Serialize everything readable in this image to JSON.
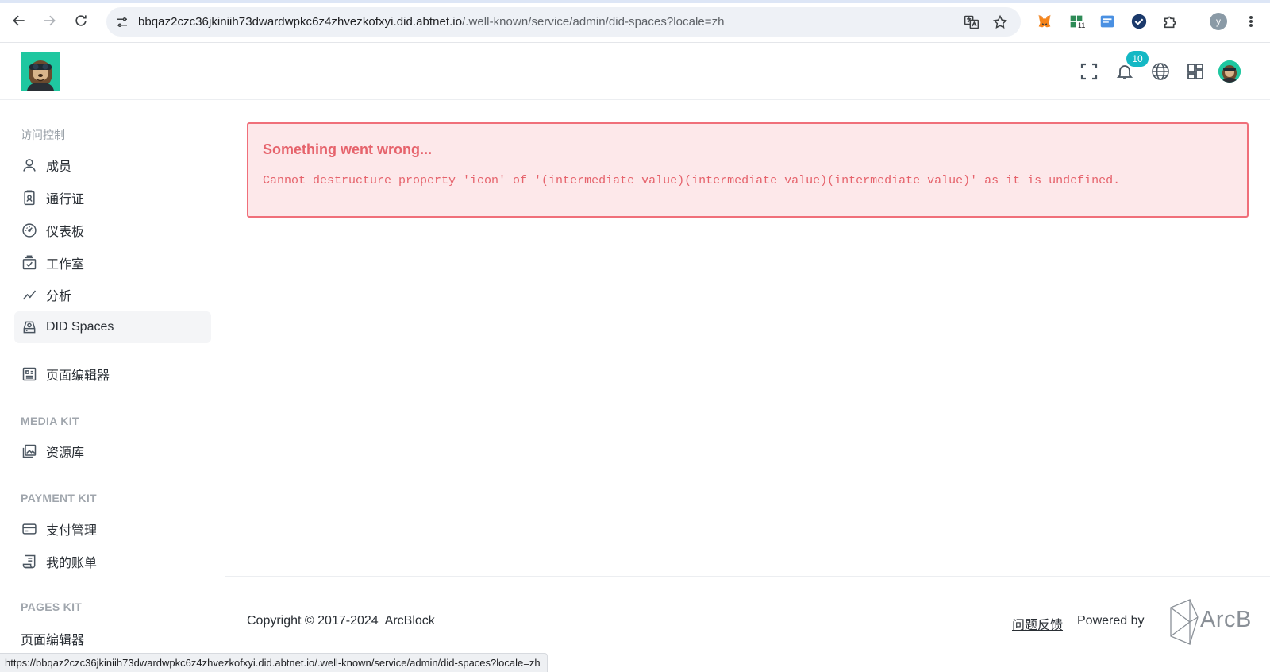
{
  "browser": {
    "url_host": "bbqaz2czc36jkiniih73dwardwpkc6z4zhvezkofxyi.did.abtnet.io",
    "url_path": "/.well-known/service/admin/did-spaces?locale=zh",
    "extension_badge": "11",
    "profile_initial": "y",
    "status_url": "https://bbqaz2czc36jkiniih73dwardwpkc6z4zhvezkofxyi.did.abtnet.io/.well-known/service/admin/did-spaces?locale=zh"
  },
  "header": {
    "notification_count": "10"
  },
  "sidebar": {
    "access_control": {
      "title": "访问控制",
      "items": [
        {
          "label": "成员",
          "icon": "user-icon"
        },
        {
          "label": "通行证",
          "icon": "passport-icon"
        },
        {
          "label": "仪表板",
          "icon": "dashboard-icon"
        },
        {
          "label": "工作室",
          "icon": "studio-icon"
        },
        {
          "label": "分析",
          "icon": "analytics-icon"
        },
        {
          "label": "DID Spaces",
          "icon": "did-spaces-icon",
          "active": true
        }
      ]
    },
    "page_editor": {
      "label": "页面编辑器",
      "icon": "page-editor-icon"
    },
    "media_kit": {
      "title": "MEDIA KIT",
      "items": [
        {
          "label": "资源库",
          "icon": "image-library-icon"
        }
      ]
    },
    "payment_kit": {
      "title": "PAYMENT KIT",
      "items": [
        {
          "label": "支付管理",
          "icon": "credit-card-icon"
        },
        {
          "label": "我的账单",
          "icon": "receipt-icon"
        }
      ]
    },
    "pages_kit": {
      "title": "PAGES KIT",
      "items": [
        {
          "label": "页面编辑器"
        }
      ]
    }
  },
  "error": {
    "title": "Something went wrong...",
    "message": "Cannot destructure property 'icon' of '(intermediate value)(intermediate value)(intermediate value)' as it is undefined."
  },
  "footer": {
    "copyright": "Copyright © 2017-2024  ArcBlock",
    "feedback": "问题反馈",
    "powered_by": "Powered by",
    "brand": "ArcB"
  },
  "colors": {
    "error_bg": "#fde8ea",
    "error_border": "#f06f7a",
    "error_text": "#e6636c",
    "badge": "#14b8c4",
    "logo_bg": "#1fc7a0"
  }
}
